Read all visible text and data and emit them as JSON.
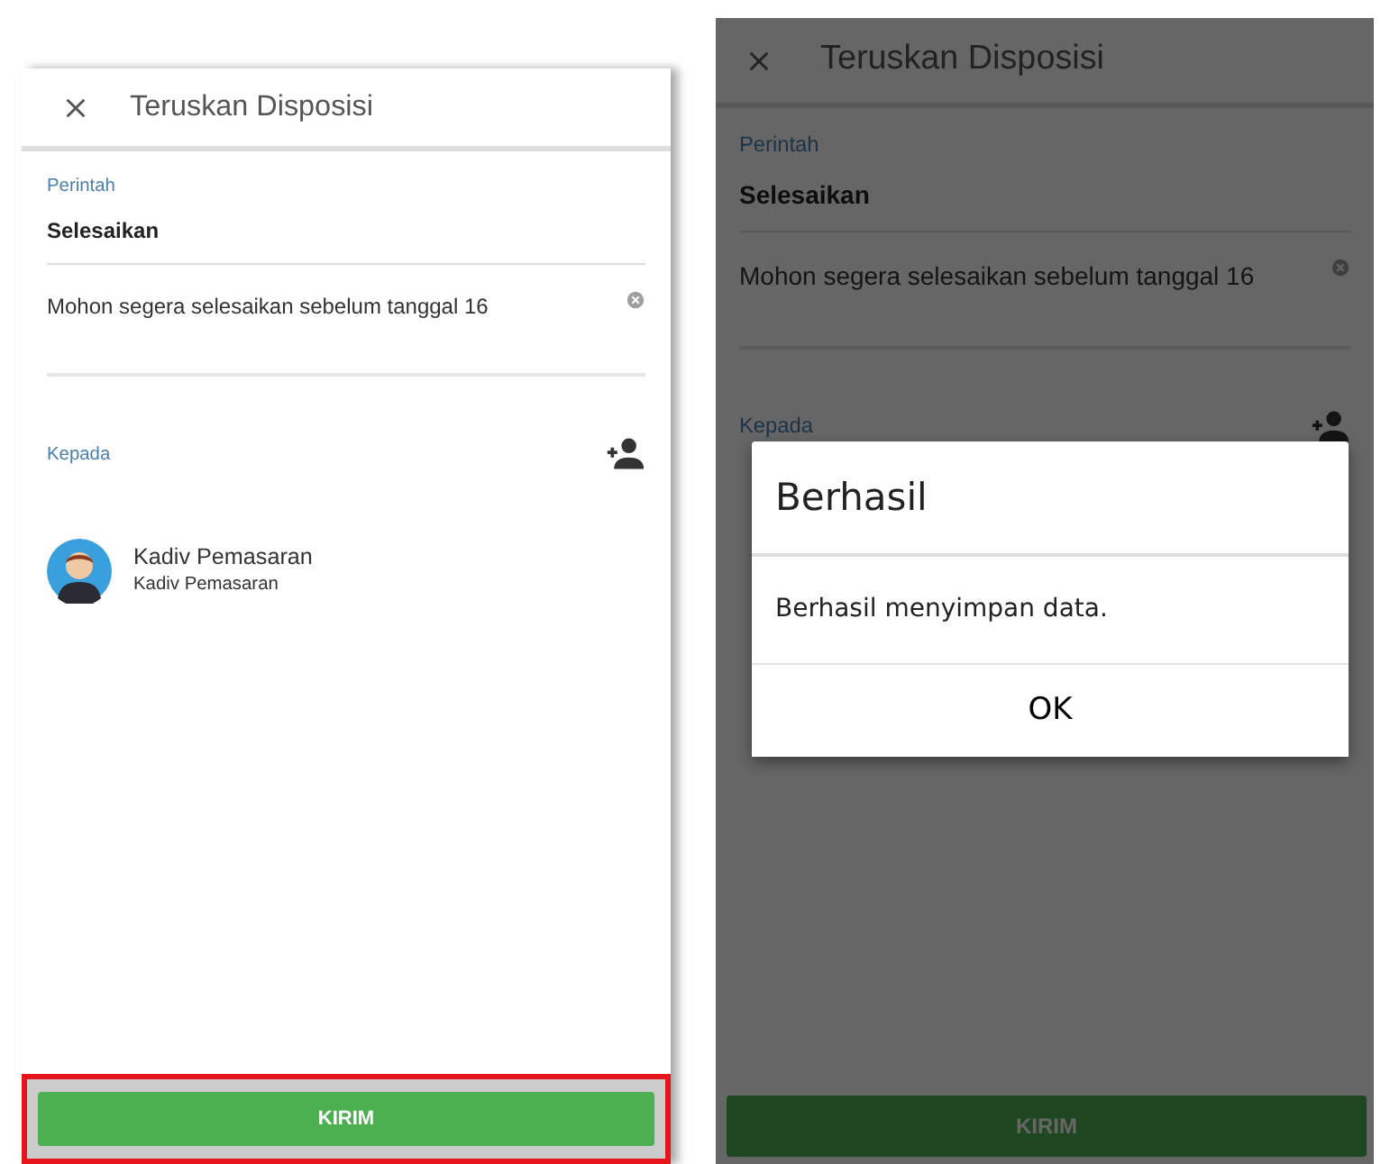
{
  "screens": [
    {
      "title": "Teruskan Disposisi",
      "command": {
        "label": "Perintah",
        "value": "Selesaikan"
      },
      "note": {
        "value": "Mohon segera selesaikan sebelum tanggal 16"
      },
      "recipients_label": "Kepada",
      "recipients": [
        {
          "name": "Kadiv Pemasaran",
          "role": "Kadiv Pemasaran"
        }
      ],
      "submit": {
        "label": "KIRIM",
        "highlighted": true
      },
      "dimmed": false
    },
    {
      "title": "Teruskan Disposisi",
      "command": {
        "label": "Perintah",
        "value": "Selesaikan"
      },
      "note": {
        "value": "Mohon segera selesaikan sebelum tanggal 16"
      },
      "recipients_label": "Kepada",
      "submit": {
        "label": "KIRIM",
        "highlighted": false
      },
      "dimmed": true,
      "dialog": {
        "title": "Berhasil",
        "message": "Berhasil menyimpan data.",
        "button": "OK"
      }
    }
  ]
}
